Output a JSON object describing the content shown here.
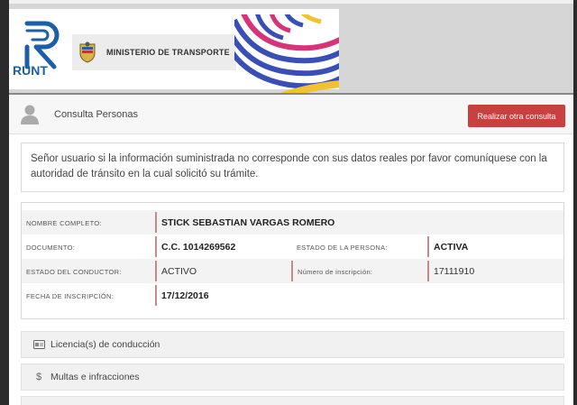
{
  "header": {
    "logo_text": "RUNT",
    "ministerio": "MINISTERIO DE TRANSPORTE"
  },
  "topbar": {
    "title": "Consulta Personas",
    "button_label": "Realizar otra consulta"
  },
  "notice": "Señor usuario si la información suministrada no corresponde con sus datos reales por favor comuníquese con la autoridad de tránsito en la cual solicitó su trámite.",
  "person": {
    "nombre_label": "NOMBRE COMPLETO:",
    "nombre_value": "STICK SEBASTIAN VARGAS ROMERO",
    "documento_label": "DOCUMENTO:",
    "documento_value": "C.C. 1014269562",
    "estado_persona_label": "ESTADO DE LA PERSONA:",
    "estado_persona_value": "ACTIVA",
    "estado_conductor_label": "ESTADO DEL CONDUCTOR:",
    "estado_conductor_value": "ACTIVO",
    "numero_inscripcion_label": "Número de inscripción:",
    "numero_inscripcion_value": "17111910",
    "fecha_label": "FECHA DE INSCRIPCIÓN:",
    "fecha_value": "17/12/2016"
  },
  "sections": [
    {
      "label": "Licencia(s) de conducción",
      "icon": "license-card-icon"
    },
    {
      "label": "Multas e infracciones",
      "icon": "dollar-icon"
    }
  ],
  "colors": {
    "accent_button": "#c9413f",
    "runt_blue": "#1c5fa8",
    "separator": "#c48b8b"
  }
}
